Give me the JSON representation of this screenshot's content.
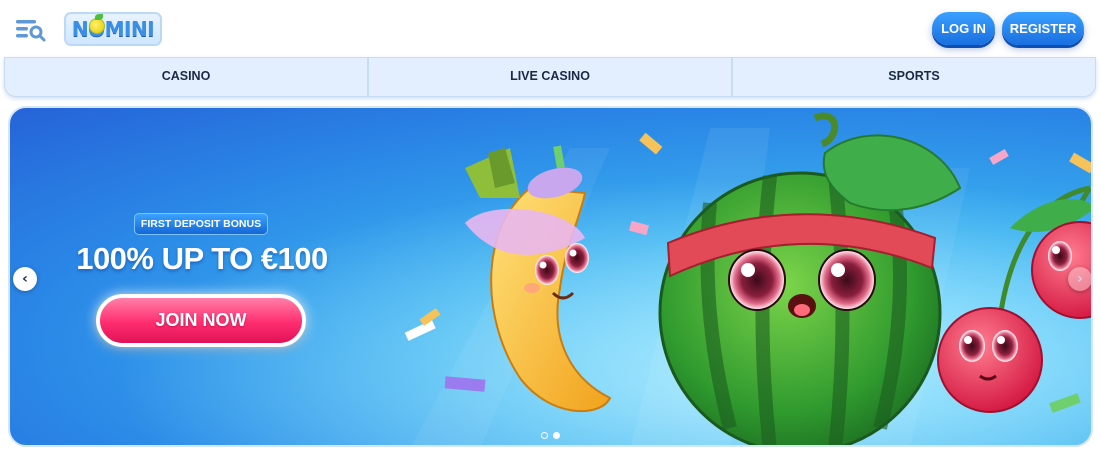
{
  "header": {
    "menu_icon": "menu-search-icon",
    "logo_text": "NOMINI",
    "login_label": "LOG IN",
    "register_label": "REGISTER",
    "accent_color": "#1a6fe0"
  },
  "nav": {
    "tabs": [
      {
        "label": "CASINO"
      },
      {
        "label": "LIVE CASINO"
      },
      {
        "label": "SPORTS"
      }
    ]
  },
  "banner": {
    "badge": "FIRST DEPOSIT BONUS",
    "headline": "100% UP TO €100",
    "cta_label": "JOIN NOW",
    "cta_color": "#ff2d6f",
    "prev_icon": "chevron-left-icon",
    "next_icon": "chevron-right-icon",
    "slides_total": 2,
    "active_slide": 2,
    "art": [
      "banana-character",
      "watermelon-character",
      "cherry-characters",
      "confetti"
    ]
  }
}
